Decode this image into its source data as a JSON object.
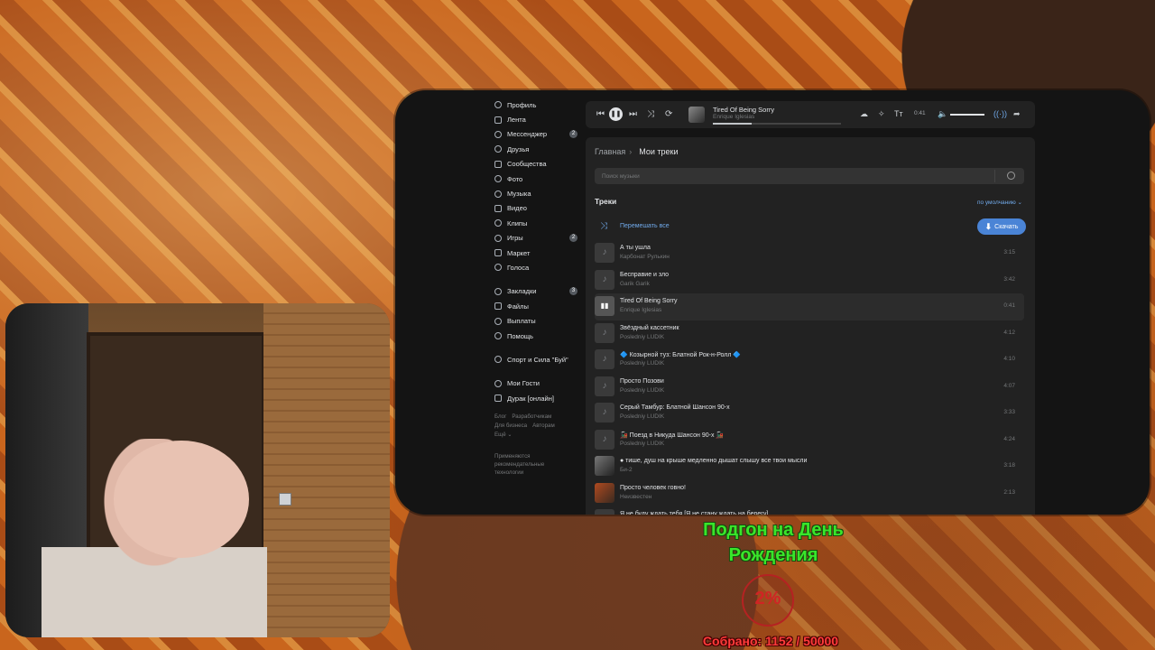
{
  "nav": {
    "items": [
      {
        "label": "Профиль",
        "icon": "profile-icon",
        "badge": ""
      },
      {
        "label": "Лента",
        "icon": "feed-icon",
        "badge": ""
      },
      {
        "label": "Мессенджер",
        "icon": "messenger-icon",
        "badge": "2"
      },
      {
        "label": "Друзья",
        "icon": "friends-icon",
        "badge": ""
      },
      {
        "label": "Сообщества",
        "icon": "communities-icon",
        "badge": ""
      },
      {
        "label": "Фото",
        "icon": "photo-icon",
        "badge": ""
      },
      {
        "label": "Музыка",
        "icon": "music-icon",
        "badge": ""
      },
      {
        "label": "Видео",
        "icon": "video-icon",
        "badge": ""
      },
      {
        "label": "Клипы",
        "icon": "clips-icon",
        "badge": ""
      },
      {
        "label": "Игры",
        "icon": "games-icon",
        "badge": "2"
      },
      {
        "label": "Маркет",
        "icon": "market-icon",
        "badge": ""
      },
      {
        "label": "Голоса",
        "icon": "votes-icon",
        "badge": ""
      }
    ],
    "items2": [
      {
        "label": "Закладки",
        "icon": "bookmarks-icon",
        "badge": "3"
      },
      {
        "label": "Файлы",
        "icon": "files-icon",
        "badge": ""
      },
      {
        "label": "Выплаты",
        "icon": "payouts-icon",
        "badge": ""
      },
      {
        "label": "Помощь",
        "icon": "help-icon",
        "badge": ""
      }
    ],
    "items3": [
      {
        "label": "Спорт и Сила \"Буй\"",
        "icon": "group-icon"
      }
    ],
    "items4": [
      {
        "label": "Мои Гости",
        "icon": "app-icon"
      },
      {
        "label": "Дурак [онлайн]",
        "icon": "game-icon"
      }
    ],
    "footer": {
      "blog": "Блог",
      "developers": "Разработчикам",
      "business": "Для бизнеса",
      "authors": "Авторам",
      "more": "Ещё ⌄",
      "note": "Применяются рекомендательные технологии"
    }
  },
  "player": {
    "title": "Tired Of Being Sorry",
    "artist": "Enrique Iglesias",
    "time": "0:41",
    "progress": 0.3,
    "volume": 1.0
  },
  "breadcrumb": {
    "home": "Главная",
    "current": "Мои треки"
  },
  "search": {
    "placeholder": "Поиск музыки"
  },
  "section": {
    "title": "Треки",
    "sort": "по умолчанию ⌄"
  },
  "shuffle_label": "Перемешать все",
  "download_label": "Скачать",
  "tracks": [
    {
      "title": "А ты ушла",
      "artist": "Карбонат Рулькин",
      "duration": "3:15",
      "cover": "note"
    },
    {
      "title": "Бесправие и зло",
      "artist": "Garik Garik",
      "duration": "3:42",
      "cover": "note"
    },
    {
      "title": "Tired Of Being Sorry",
      "artist": "Enrique Iglesias",
      "duration": "0:41",
      "cover": "playing",
      "active": true
    },
    {
      "title": "Звёздный кассетник",
      "artist": "Posledniy LUDIK",
      "duration": "4:12",
      "cover": "note"
    },
    {
      "title": "🔷 Козырной туз: Блатной Рок-н-Ролл 🔷",
      "artist": "Posledniy LUDIK",
      "duration": "4:10",
      "cover": "note"
    },
    {
      "title": "Просто Позови",
      "artist": "Posledniy LUDIK",
      "duration": "4:07",
      "cover": "note"
    },
    {
      "title": "Серый Тамбур: Блатной Шансон 90-х",
      "artist": "Posledniy LUDIK",
      "duration": "3:33",
      "cover": "note"
    },
    {
      "title": "🚂 Поезд в Никуда Шансон 90-х 🚂",
      "artist": "Posledniy LUDIK",
      "duration": "4:24",
      "cover": "note"
    },
    {
      "title": "● тише, душ на крыше медленно дышат слышу все твои мысли",
      "artist": "Би-2",
      "duration": "3:18",
      "cover": "photo"
    },
    {
      "title": "Просто человек говно!",
      "artist": "Неизвестен",
      "duration": "2:13",
      "cover": "photo2"
    },
    {
      "title": "Я не буду ждать тебя [Я не стану ждать на берегу]",
      "artist": "",
      "duration": "",
      "cover": "note"
    }
  ],
  "goal": {
    "title": "Подгон на День Рождения",
    "percent": "2%",
    "collected": "Собрано: 1152 / 50000"
  }
}
